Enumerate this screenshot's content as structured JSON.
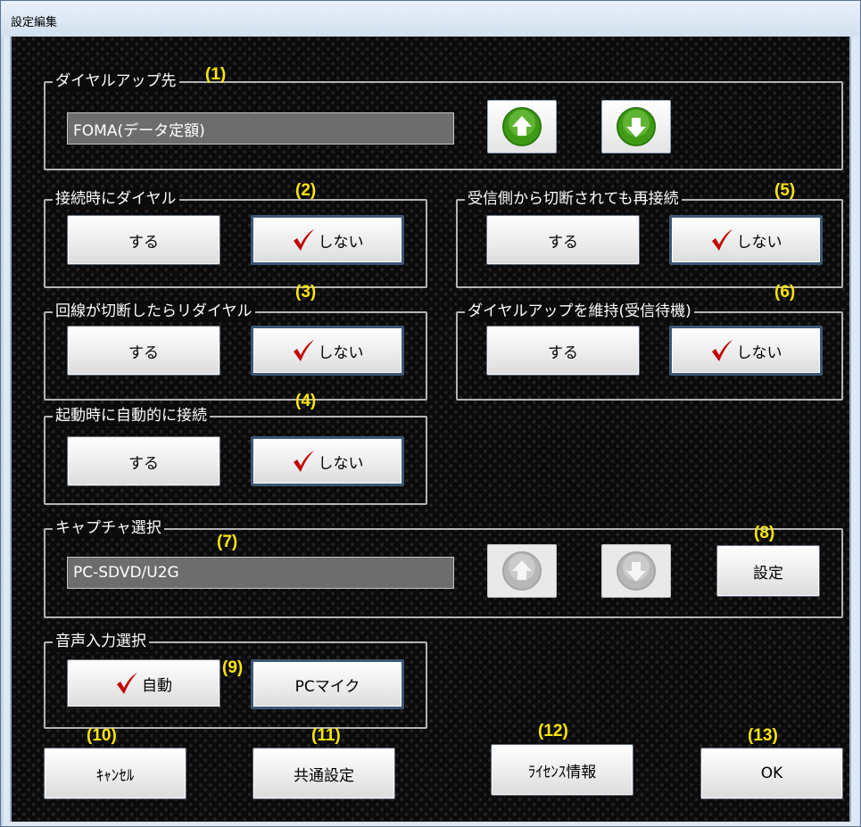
{
  "window": {
    "title": "設定編集"
  },
  "dialup_dest": {
    "label": "ダイヤルアップ先",
    "num": "(1)",
    "value": "FOMA(データ定額)",
    "up_icon": "arrow-up-icon",
    "down_icon": "arrow-down-icon"
  },
  "dial_on_connect": {
    "label": "接続時にダイヤル",
    "num": "(2)",
    "yes": "する",
    "no": "しない",
    "selected": "no"
  },
  "redial_on_disconnect": {
    "label": "回線が切断したらリダイヤル",
    "num": "(3)",
    "yes": "する",
    "no": "しない",
    "selected": "no"
  },
  "auto_connect_on_start": {
    "label": "起動時に自動的に接続",
    "num": "(4)",
    "yes": "する",
    "no": "しない",
    "selected": "no"
  },
  "reconnect_on_remote_cut": {
    "label": "受信側から切断されても再接続",
    "num": "(5)",
    "yes": "する",
    "no": "しない",
    "selected": "no"
  },
  "keep_dialup": {
    "label": "ダイヤルアップを維持(受信待機)",
    "num": "(6)",
    "yes": "する",
    "no": "しない",
    "selected": "no"
  },
  "capture": {
    "label": "キャプチャ選択",
    "num": "(7)",
    "value": "PC-SDVD/U2G",
    "settings_num": "(8)",
    "settings_label": "設定"
  },
  "audio_input": {
    "label": "音声入力選択",
    "num": "(9)",
    "auto_label": "自動",
    "pc_mic_label": "PCマイク",
    "selected": "auto"
  },
  "footer": {
    "cancel_num": "(10)",
    "cancel_label": "ｷｬﾝｾﾙ",
    "common_num": "(11)",
    "common_label": "共通設定",
    "license_num": "(12)",
    "license_label": "ﾗｲｾﾝｽ情報",
    "ok_num": "(13)",
    "ok_label": "OK"
  },
  "colors": {
    "check": "#c20000",
    "label_number": "#ffe600",
    "arrow_green": "#3f9b16",
    "arrow_disabled": "#b7b7b7"
  }
}
